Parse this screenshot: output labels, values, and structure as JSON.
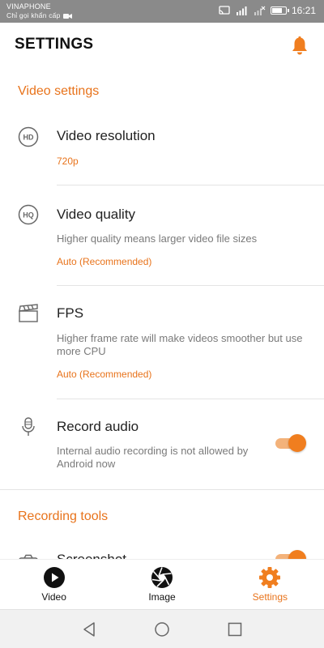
{
  "status_bar": {
    "carrier": "VINAPHONE",
    "carrier_sub": "Chỉ gọi khẩn cấp",
    "time": "16:21",
    "battery_level": 0.8
  },
  "header": {
    "title": "SETTINGS"
  },
  "sections": {
    "video": {
      "label": "Video settings",
      "items": [
        {
          "title": "Video resolution",
          "value": "720p",
          "icon": "hd-icon"
        },
        {
          "title": "Video quality",
          "desc": "Higher quality means larger video file sizes",
          "value": "Auto (Recommended)",
          "icon": "hq-icon"
        },
        {
          "title": "FPS",
          "desc": "Higher frame rate will make videos smoother but use more CPU",
          "value": "Auto (Recommended)",
          "icon": "clapperboard-icon"
        },
        {
          "title": "Record audio",
          "desc": "Internal audio recording is not allowed by Android now",
          "icon": "microphone-icon",
          "toggle_on": true
        }
      ]
    },
    "recording": {
      "label": "Recording tools",
      "items": [
        {
          "title": "Screenshot",
          "icon": "camera-icon",
          "toggle_on": true
        }
      ]
    }
  },
  "bottom_nav": {
    "items": [
      {
        "label": "Video",
        "icon": "play-circle-icon"
      },
      {
        "label": "Image",
        "icon": "aperture-icon"
      },
      {
        "label": "Settings",
        "icon": "gear-icon",
        "active": true
      }
    ]
  },
  "colors": {
    "accent": "#e8731b",
    "toggle_thumb": "#f07e1f",
    "toggle_track": "#f3b27a",
    "status_bar": "#8a8a8a"
  }
}
